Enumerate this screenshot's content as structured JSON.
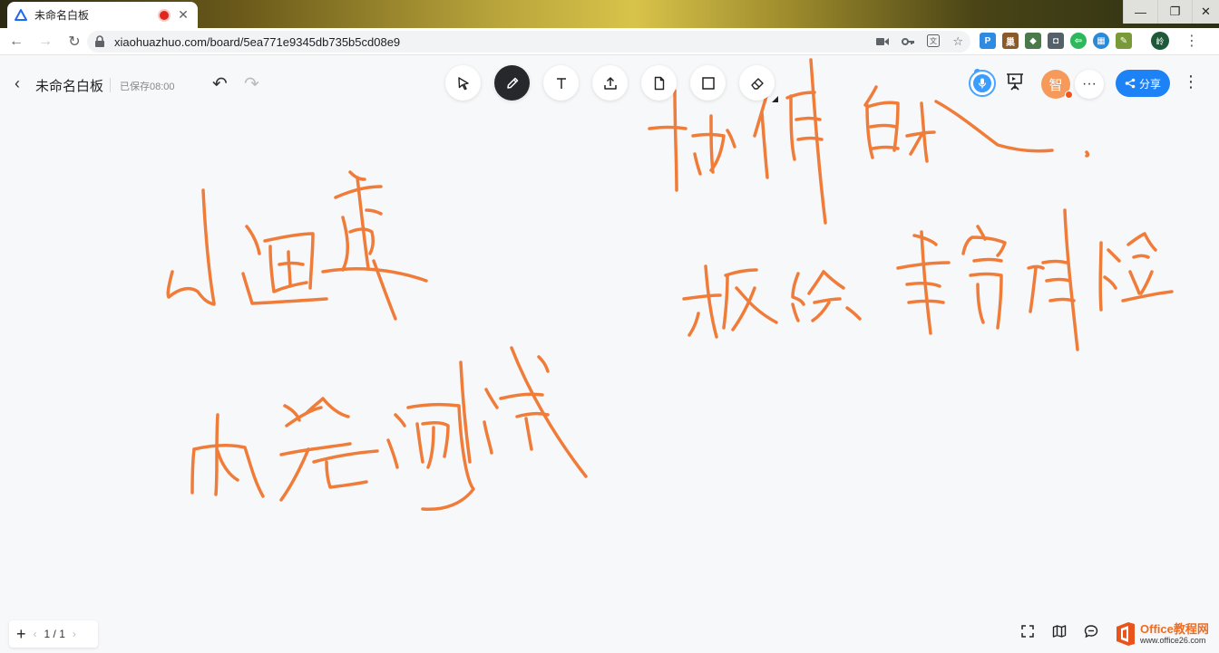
{
  "browser": {
    "tab_title": "未命名白板",
    "url": "xiaohuazhuo.com/board/5ea771e9345db735b5cd08e9",
    "profile_initial": "岭",
    "window_controls": {
      "minimize": "—",
      "restore": "❐",
      "close": "✕"
    }
  },
  "header": {
    "back_label": "‹",
    "title": "未命名白板",
    "saved_status": "已保存08:00",
    "undo": "↶",
    "redo": "↷",
    "tools": [
      "select-tool",
      "pen-tool",
      "text-tool",
      "upload-tool",
      "file-tool",
      "shape-tool",
      "eraser-tool"
    ],
    "active_tool": "pen-tool",
    "avatar_text": "智",
    "more_label": "···",
    "share_label": "分享",
    "menu_label": "⋮"
  },
  "canvas": {
    "ink_color": "#f07c3a",
    "handwriting": [
      "小白画桌",
      "内容测试",
      "协作白板",
      "板绘书写体验"
    ]
  },
  "footer": {
    "add_label": "+",
    "page_indicator": "1 / 1",
    "prev": "‹",
    "next": "›",
    "watermark_brand": "Office教程网",
    "watermark_url": "www.office26.com"
  },
  "colors": {
    "accent": "#1d82f5",
    "ink": "#f07c3a",
    "avatar": "#f59a5a"
  }
}
